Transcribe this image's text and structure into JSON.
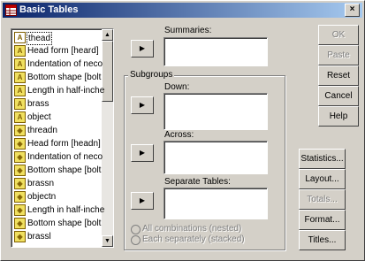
{
  "window": {
    "title": "Basic Tables",
    "close_label": "×"
  },
  "variables": [
    {
      "label": "thead",
      "icon": "ruler-icon",
      "selected": true
    },
    {
      "label": "Head form [heard]",
      "icon": "ruler-icon"
    },
    {
      "label": "Indentation of neco",
      "icon": "ruler-icon"
    },
    {
      "label": "Bottom shape [bolt",
      "icon": "ruler-icon"
    },
    {
      "label": "Length in half-inche",
      "icon": "ruler-icon"
    },
    {
      "label": "brass",
      "icon": "ruler-icon"
    },
    {
      "label": "object",
      "icon": "ruler-icon"
    },
    {
      "label": "threadn",
      "icon": "nominal-icon"
    },
    {
      "label": "Head form [headn]",
      "icon": "nominal-icon"
    },
    {
      "label": "Indentation of neco",
      "icon": "nominal-icon"
    },
    {
      "label": "Bottom shape [bolt",
      "icon": "nominal-icon"
    },
    {
      "label": "brassn",
      "icon": "nominal-icon"
    },
    {
      "label": "objectn",
      "icon": "nominal-icon"
    },
    {
      "label": "Length in half-inche",
      "icon": "nominal-icon"
    },
    {
      "label": "Bottom shape [bolt",
      "icon": "nominal-icon"
    },
    {
      "label": "brassl",
      "icon": "nominal-icon"
    }
  ],
  "summaries": {
    "label": "Summaries:"
  },
  "subgroups": {
    "title": "Subgroups",
    "down_label": "Down:",
    "across_label": "Across:",
    "separate_label": "Separate Tables:",
    "radio_all": "All combinations (nested)",
    "radio_each": "Each separately (stacked)"
  },
  "buttons": {
    "ok": "OK",
    "paste": "Paste",
    "reset": "Reset",
    "cancel": "Cancel",
    "help": "Help",
    "statistics": "Statistics...",
    "layout": "Layout...",
    "totals": "Totals...",
    "format": "Format...",
    "titles": "Titles..."
  },
  "arrow_glyph": "▶"
}
